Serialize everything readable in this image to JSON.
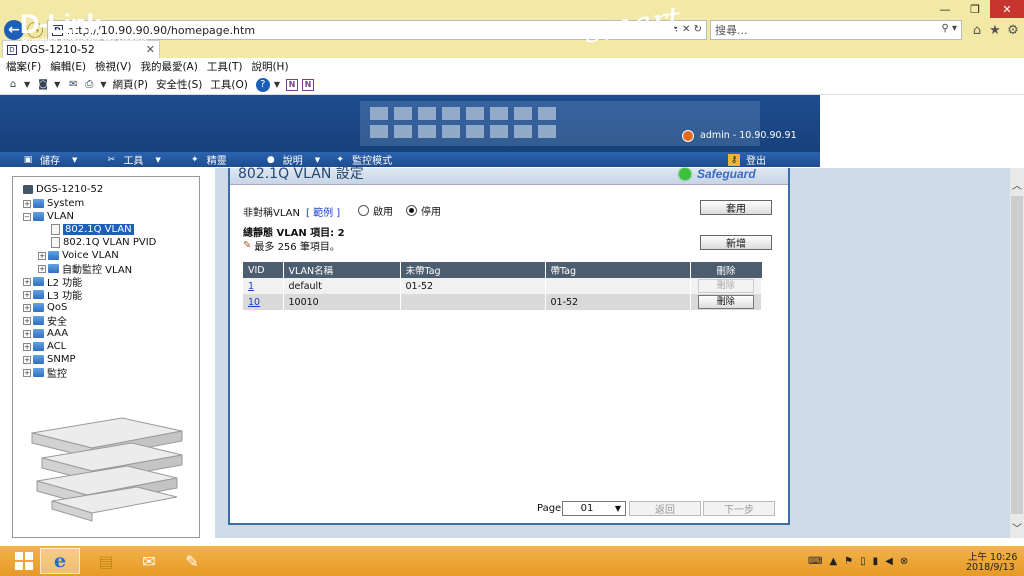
{
  "browser": {
    "address": "http://10.90.90.90/homepage.htm",
    "search_placeholder": "搜尋...",
    "tab_title": "DGS-1210-52",
    "menu": [
      "檔案(F)",
      "編輯(E)",
      "檢視(V)",
      "我的最愛(A)",
      "工具(T)",
      "說明(H)"
    ],
    "commands": [
      "網頁(P)",
      "安全性(S)",
      "工具(O)"
    ]
  },
  "header": {
    "logo": "D-Link",
    "slogan": "Building Networks for People",
    "smart": "smart",
    "user": "admin - 10.90.90.91"
  },
  "nav": {
    "save": "儲存",
    "tools": "工具",
    "wizard": "精靈",
    "help": "說明",
    "monitor": "監控模式",
    "logout": "登出"
  },
  "tree": {
    "root": "DGS-1210-52",
    "system": "System",
    "vlan": "VLAN",
    "vlan_8021q": "802.1Q VLAN",
    "vlan_pvid": "802.1Q VLAN PVID",
    "voice_vlan": "Voice VLAN",
    "auto_monitor_vlan": "自動監控 VLAN",
    "l2": "L2 功能",
    "l3": "L3 功能",
    "qos": "QoS",
    "security": "安全",
    "aaa": "AAA",
    "acl": "ACL",
    "snmp": "SNMP",
    "monitoring": "監控"
  },
  "page": {
    "title": "802.1Q VLAN 設定",
    "safeguard": "Safeguard",
    "asym_label": "非對稱VLAN",
    "example_link": "[ 範例 ]",
    "enable": "啟用",
    "disable": "停用",
    "apply": "套用",
    "total_label": "總靜態 VLAN 項目: 2",
    "max_note": "最多 256 筆項目。",
    "add": "新增",
    "page_label": "Page",
    "page_value": "01",
    "prev": "返回",
    "next": "下一步"
  },
  "table": {
    "headers": [
      "VID",
      "VLAN名稱",
      "未帶Tag",
      "帶Tag",
      "刪除"
    ],
    "rows": [
      {
        "vid": "1",
        "name": "default",
        "untagged": "01-52",
        "tagged": "",
        "delete": "刪除"
      },
      {
        "vid": "10",
        "name": "10010",
        "untagged": "",
        "tagged": "01-52",
        "delete": "刪除"
      }
    ]
  },
  "taskbar": {
    "time": "上午 10:26",
    "date": "2018/9/13"
  },
  "colors": {
    "banner": "#1e4c8e",
    "table_header": "#4b5d6f",
    "taskbar": "#e9a02f",
    "selected": "#1d5fbd"
  }
}
